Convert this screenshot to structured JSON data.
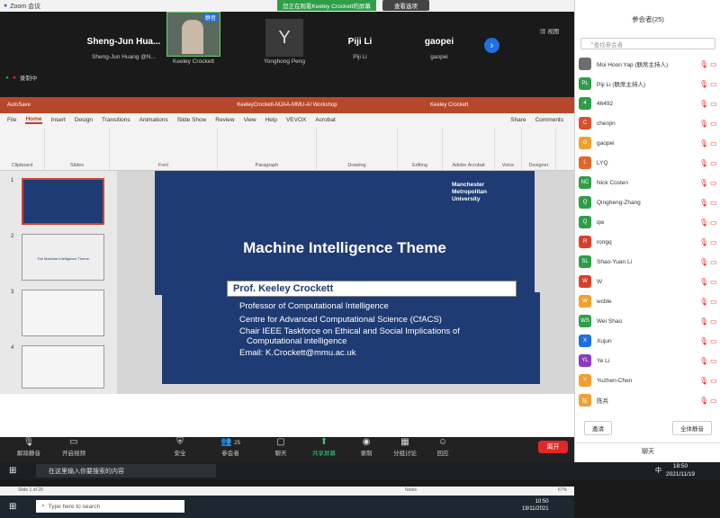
{
  "zoom": {
    "app_title": "Zoom 会议",
    "share_banner": "您正在观看Keeley Crockett的屏幕",
    "view_options": "查看选项",
    "view_label": "视图",
    "recording": "录制中"
  },
  "gallery": [
    {
      "name": "Sheng-Jun  Hua...",
      "sub": "Sheng-Jun Huang @N..."
    },
    {
      "name": "",
      "sub": "Keeley Crockett",
      "badge": "静音"
    },
    {
      "name": "Y",
      "sub": "Yonghong Peng"
    },
    {
      "name": "Piji Li",
      "sub": "Piji Li"
    },
    {
      "name": "gaopei",
      "sub": "gaopei"
    }
  ],
  "ppt": {
    "title": "KeeleyCrockett-MJAA-MMU-AI Workshop",
    "autosave": "AutoSave",
    "user": "Keeley Crockett",
    "tabs": [
      "File",
      "Home",
      "Insert",
      "Design",
      "Transitions",
      "Animations",
      "Slide Show",
      "Review",
      "View",
      "Help",
      "VEVOX",
      "Acrobat"
    ],
    "share": "Share",
    "comments": "Comments",
    "groups": [
      "Clipboard",
      "Slides",
      "Font",
      "Paragraph",
      "Drawing",
      "Editing",
      "Adobe Acrobat",
      "Voice",
      "Designer"
    ],
    "slide_nums": [
      "1",
      "2",
      "3",
      "4"
    ],
    "thumb2_title": "The Machine Intelligence Theme",
    "status_left": "Slide 1 of 29",
    "status_zoom": "67%",
    "notes": "Notes"
  },
  "slide": {
    "uni": [
      "Manchester",
      "Metropolitan",
      "University"
    ],
    "title": "Machine Intelligence Theme",
    "name": "Prof. Keeley Crockett",
    "lines": [
      "Professor of Computational Intelligence",
      "Centre for Advanced Computational Science (CfACS)",
      "Chair IEEE Taskforce on Ethical and Social Implications of",
      "Computational intelligence",
      "Email: K.Crockett@mmu.ac.uk"
    ]
  },
  "remote_taskbar": {
    "search": "Type here to search",
    "time": "10:50",
    "date": "19/11/2021"
  },
  "toolbar": {
    "items": [
      "解除静音",
      "开启视频",
      "安全",
      "参会者",
      "聊天",
      "共享屏幕",
      "录制",
      "分组讨论",
      "回应"
    ],
    "participants_count": "25",
    "end": "离开"
  },
  "participants": {
    "title": "参会者(25)",
    "search_placeholder": "查找参会者",
    "list": [
      {
        "name": "Moi Hoon Yap (联席主持人)",
        "initials": "",
        "color": "#6d6d6d"
      },
      {
        "name": "Piji Li (联席主持人)",
        "initials": "PL",
        "color": "#2e9e48"
      },
      {
        "name": "46492",
        "initials": "4",
        "color": "#2e9e48"
      },
      {
        "name": "chenjin",
        "initials": "C",
        "color": "#d9502a"
      },
      {
        "name": "gaopei",
        "initials": "G",
        "color": "#f0a030"
      },
      {
        "name": "LYQ",
        "initials": "L",
        "color": "#e0662a"
      },
      {
        "name": "Nick Costen",
        "initials": "NC",
        "color": "#2e9e48"
      },
      {
        "name": "Qingheng-Zhang",
        "initials": "Q",
        "color": "#2e9e48"
      },
      {
        "name": "qw",
        "initials": "Q",
        "color": "#2e9e48"
      },
      {
        "name": "rongq",
        "initials": "R",
        "color": "#d9402a"
      },
      {
        "name": "Shao-Yuan Li",
        "initials": "SL",
        "color": "#2e9e48"
      },
      {
        "name": "W",
        "initials": "W",
        "color": "#d9402a"
      },
      {
        "name": "wcble",
        "initials": "W",
        "color": "#f0a030"
      },
      {
        "name": "Wei Shao",
        "initials": "WS",
        "color": "#2e9e48"
      },
      {
        "name": "Xujun",
        "initials": "X",
        "color": "#1f6fe0"
      },
      {
        "name": "Ye Li",
        "initials": "YL",
        "color": "#8a3ac0"
      },
      {
        "name": "Yuzhen-Chen",
        "initials": "Y",
        "color": "#f0a030"
      },
      {
        "name": "陈兵",
        "initials": "陈",
        "color": "#f0a030"
      }
    ],
    "invite": "邀请",
    "mute_all": "全体静音",
    "chat": "聊天"
  },
  "host_taskbar": {
    "search": "在这里输入你要搜索的内容",
    "time": "18:50",
    "date": "2021/11/19",
    "lang": "中"
  }
}
